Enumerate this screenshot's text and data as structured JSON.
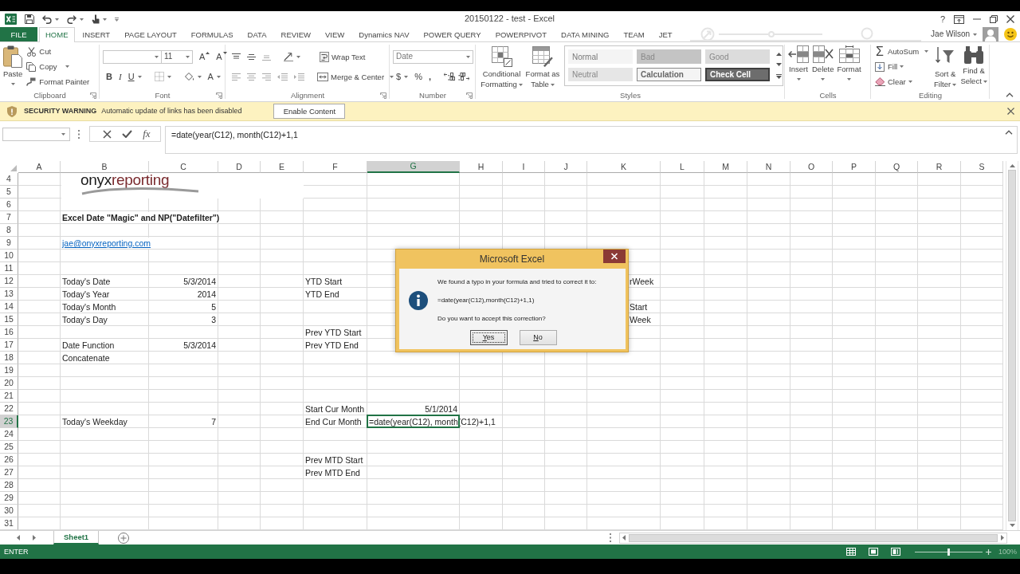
{
  "window": {
    "title": "20150122 - test - Excel",
    "help": "?"
  },
  "ribbon_tabs": [
    {
      "label": "FILE",
      "kind": "file",
      "selected": false
    },
    {
      "label": "HOME",
      "kind": "tab",
      "selected": true
    },
    {
      "label": "INSERT",
      "kind": "tab",
      "selected": false
    },
    {
      "label": "PAGE LAYOUT",
      "kind": "tab",
      "selected": false
    },
    {
      "label": "FORMULAS",
      "kind": "tab",
      "selected": false
    },
    {
      "label": "DATA",
      "kind": "tab",
      "selected": false
    },
    {
      "label": "REVIEW",
      "kind": "tab",
      "selected": false
    },
    {
      "label": "VIEW",
      "kind": "tab",
      "selected": false
    },
    {
      "label": "Dynamics NAV",
      "kind": "tab",
      "selected": false
    },
    {
      "label": "POWER QUERY",
      "kind": "tab",
      "selected": false
    },
    {
      "label": "POWERPIVOT",
      "kind": "tab",
      "selected": false
    },
    {
      "label": "DATA MINING",
      "kind": "tab",
      "selected": false
    },
    {
      "label": "TEAM",
      "kind": "tab",
      "selected": false
    },
    {
      "label": "JET",
      "kind": "tab",
      "selected": false
    }
  ],
  "account": {
    "name": "Jae Wilson"
  },
  "ribbon": {
    "clipboard": {
      "label": "Clipboard",
      "paste": "Paste",
      "cut": "Cut",
      "copy": "Copy",
      "format_painter": "Format Painter"
    },
    "font": {
      "label": "Font",
      "size": "11",
      "grow": "A",
      "shrink": "A",
      "bold": "B",
      "italic": "I",
      "underline": "U",
      "font_color": "A"
    },
    "alignment": {
      "label": "Alignment",
      "wrap_text": "Wrap Text",
      "merge_center": "Merge & Center"
    },
    "number": {
      "label": "Number",
      "format": "Date",
      "currency": "$",
      "percent": "%",
      "comma": ","
    },
    "styles": {
      "label": "Styles",
      "conditional_formatting": "Conditional Formatting",
      "format_as_table": "Format as Table",
      "gallery": [
        {
          "label": "Normal",
          "kind": "normal"
        },
        {
          "label": "Bad",
          "kind": "bad"
        },
        {
          "label": "Good",
          "kind": "good"
        },
        {
          "label": "Neutral",
          "kind": "neutral"
        },
        {
          "label": "Calculation",
          "kind": "calculation"
        },
        {
          "label": "Check Cell",
          "kind": "check"
        }
      ]
    },
    "cells": {
      "label": "Cells",
      "insert": "Insert",
      "delete": "Delete",
      "format": "Format"
    },
    "editing": {
      "label": "Editing",
      "autosum_symbol": "Σ",
      "autosum": "AutoSum",
      "fill": "Fill",
      "clear": "Clear",
      "sort_filter": "Sort & Filter",
      "find_select": "Find & Select"
    }
  },
  "message_bar": {
    "title": "SECURITY WARNING",
    "message": "Automatic update of links has been disabled",
    "button": "Enable Content"
  },
  "formula_bar": {
    "function_symbol": "fx",
    "formula": "=date(year(C12), month(C12)+1,1"
  },
  "sheet": {
    "columns": [
      {
        "label": "A",
        "selected": false
      },
      {
        "label": "B",
        "selected": false
      },
      {
        "label": "C",
        "selected": false
      },
      {
        "label": "D",
        "selected": false
      },
      {
        "label": "E",
        "selected": false
      },
      {
        "label": "F",
        "selected": false
      },
      {
        "label": "G",
        "selected": true
      },
      {
        "label": "H",
        "selected": false
      },
      {
        "label": "I",
        "selected": false
      },
      {
        "label": "J",
        "selected": false
      },
      {
        "label": "K",
        "selected": false
      },
      {
        "label": "L",
        "selected": false
      },
      {
        "label": "M",
        "selected": false
      },
      {
        "label": "N",
        "selected": false
      },
      {
        "label": "O",
        "selected": false
      },
      {
        "label": "P",
        "selected": false
      },
      {
        "label": "Q",
        "selected": false
      },
      {
        "label": "R",
        "selected": false
      },
      {
        "label": "S",
        "selected": false
      }
    ],
    "rows": [
      {
        "label": "4",
        "selected": false
      },
      {
        "label": "5",
        "selected": false
      },
      {
        "label": "6",
        "selected": false
      },
      {
        "label": "7",
        "selected": false,
        "cells": {
          "b": {
            "text": "Excel Date \"Magic\" and NP(\"Datefilter\")",
            "kind": "heading"
          }
        }
      },
      {
        "label": "8",
        "selected": false
      },
      {
        "label": "9",
        "selected": false,
        "cells": {
          "b": {
            "text": "jae@onyxreporting.com",
            "kind": "link"
          }
        }
      },
      {
        "label": "10",
        "selected": false
      },
      {
        "label": "11",
        "selected": false
      },
      {
        "label": "12",
        "selected": false,
        "cells": {
          "b": {
            "text": "Today's Date",
            "kind": "text"
          },
          "c": {
            "text": "5/3/2014",
            "kind": "number"
          },
          "f": {
            "text": "YTD Start",
            "kind": "text"
          },
          "k": {
            "text": "rWeek",
            "kind": "text"
          }
        }
      },
      {
        "label": "13",
        "selected": false,
        "cells": {
          "b": {
            "text": "Today's Year",
            "kind": "text"
          },
          "c": {
            "text": "2014",
            "kind": "number"
          },
          "f": {
            "text": "YTD End",
            "kind": "text"
          }
        }
      },
      {
        "label": "14",
        "selected": false,
        "cells": {
          "b": {
            "text": "Today's Month",
            "kind": "text"
          },
          "c": {
            "text": "5",
            "kind": "number"
          },
          "k": {
            "text": "Start",
            "kind": "text"
          }
        }
      },
      {
        "label": "15",
        "selected": false,
        "cells": {
          "b": {
            "text": "Today's Day",
            "kind": "text"
          },
          "c": {
            "text": "3",
            "kind": "number"
          },
          "k": {
            "text": "Week",
            "kind": "text"
          }
        }
      },
      {
        "label": "16",
        "selected": false,
        "cells": {
          "f": {
            "text": "Prev YTD Start",
            "kind": "text"
          }
        }
      },
      {
        "label": "17",
        "selected": false,
        "cells": {
          "b": {
            "text": "Date Function",
            "kind": "text"
          },
          "c": {
            "text": "5/3/2014",
            "kind": "number"
          },
          "f": {
            "text": "Prev YTD End",
            "kind": "text"
          }
        }
      },
      {
        "label": "18",
        "selected": false,
        "cells": {
          "b": {
            "text": "Concatenate",
            "kind": "text"
          }
        }
      },
      {
        "label": "19",
        "selected": false
      },
      {
        "label": "20",
        "selected": false
      },
      {
        "label": "21",
        "selected": false
      },
      {
        "label": "22",
        "selected": false,
        "cells": {
          "f": {
            "text": "Start Cur Month",
            "kind": "text"
          },
          "g": {
            "text": "5/1/2014",
            "kind": "number"
          }
        }
      },
      {
        "label": "23",
        "selected": true,
        "cells": {
          "b": {
            "text": "Today's Weekday",
            "kind": "text"
          },
          "c": {
            "text": "7",
            "kind": "number"
          },
          "f": {
            "text": "End Cur Month",
            "kind": "text"
          },
          "g": {
            "text": "=date(year(C12), month(C12)+1,1",
            "kind": "editing"
          }
        }
      },
      {
        "label": "24",
        "selected": false
      },
      {
        "label": "25",
        "selected": false
      },
      {
        "label": "26",
        "selected": false,
        "cells": {
          "f": {
            "text": "Prev MTD Start",
            "kind": "text"
          }
        }
      },
      {
        "label": "27",
        "selected": false,
        "cells": {
          "f": {
            "text": "Prev MTD End",
            "kind": "text"
          }
        }
      },
      {
        "label": "28",
        "selected": false
      },
      {
        "label": "29",
        "selected": false
      },
      {
        "label": "30",
        "selected": false
      },
      {
        "label": "31",
        "selected": false
      }
    ],
    "logo": {
      "parts": [
        "onyx",
        "reporting"
      ]
    }
  },
  "dialog": {
    "title": "Microsoft Excel",
    "message": "We found a typo in your formula and tried to correct it to:",
    "formula": "=date(year(C12),month(C12)+1,1)",
    "question": "Do you want to accept this correction?",
    "buttons": [
      {
        "label": "Yes",
        "selected": true
      },
      {
        "label": "No",
        "selected": false
      }
    ]
  },
  "sheet_tabs": [
    {
      "label": "Sheet1",
      "selected": true
    }
  ],
  "status_bar": {
    "mode": "ENTER",
    "zoom": {
      "level": 0.5,
      "reading": "100%"
    }
  }
}
